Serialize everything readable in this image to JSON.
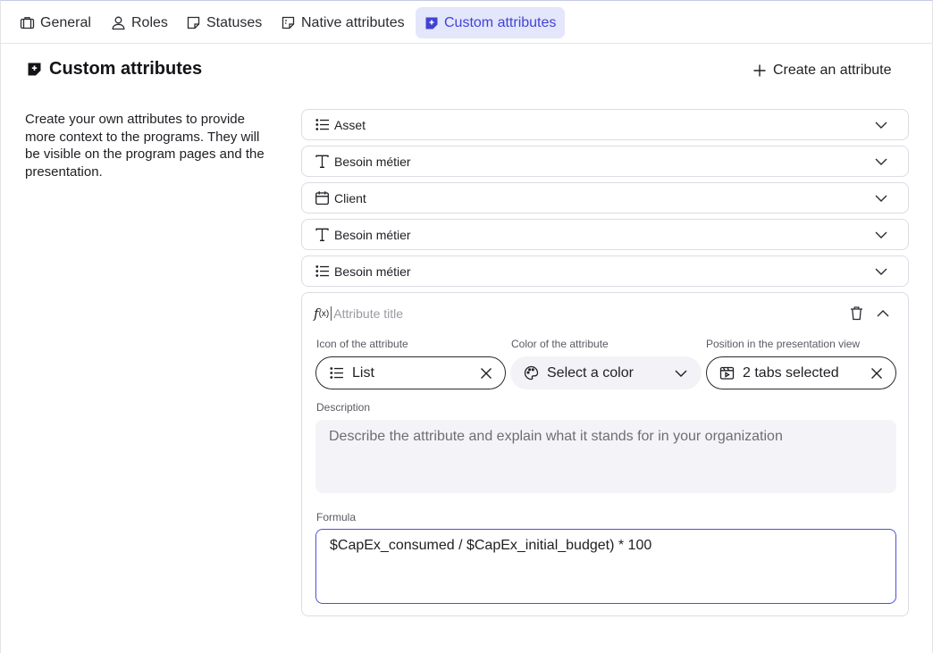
{
  "tabs": [
    {
      "label": "General",
      "icon": "briefcase-icon"
    },
    {
      "label": "Roles",
      "icon": "user-icon"
    },
    {
      "label": "Statuses",
      "icon": "sticky-note-icon"
    },
    {
      "label": "Native attributes",
      "icon": "sticky-note-dashed-icon"
    },
    {
      "label": "Custom attributes",
      "icon": "sticky-note-plus-icon",
      "active": true
    }
  ],
  "section": {
    "title": "Custom attributes",
    "create_label": "Create an attribute",
    "intro": "Create your own attributes to provide more context to the programs. They will be visible on the program pages and the presentation."
  },
  "attributes": [
    {
      "label": "Asset",
      "icon": "list-icon"
    },
    {
      "label": "Besoin métier",
      "icon": "text-icon"
    },
    {
      "label": "Client",
      "icon": "calendar-icon"
    },
    {
      "label": "Besoin métier",
      "icon": "text-icon"
    },
    {
      "label": "Besoin métier",
      "icon": "list-icon"
    }
  ],
  "editor": {
    "fx_icon": "f",
    "fx_sub": "(x)",
    "title_placeholder": "Attribute title",
    "icon_label": "Icon of the attribute",
    "icon_value": "List",
    "color_label": "Color of the attribute",
    "color_value": "Select a color",
    "position_label": "Position in the presentation view",
    "position_value": "2 tabs selected",
    "description_label": "Description",
    "description_placeholder": "Describe the attribute and explain what it stands for in your organization",
    "formula_label": "Formula",
    "formula_value": "$CapEx_consumed / $CapEx_initial_budget) * 100"
  },
  "colors": {
    "accent": "#3f44d6",
    "tab_active_bg": "#e4e6fb",
    "border": "#dcdce3"
  }
}
